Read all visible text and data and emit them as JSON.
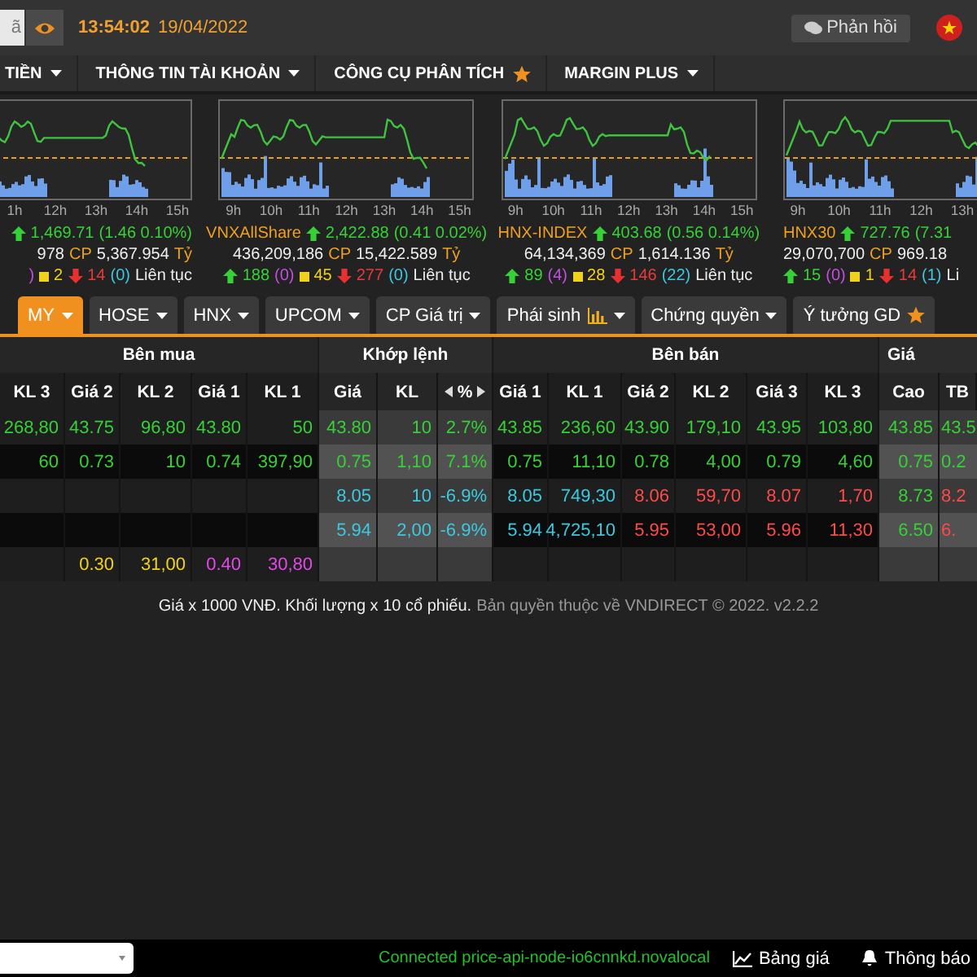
{
  "topbar": {
    "search": {
      "placeholder": "ã"
    },
    "time": "13:54:02",
    "date": "19/04/2022",
    "feedback": "Phản hồi"
  },
  "menu": [
    {
      "label": "TIỀN",
      "kind": "dropdown"
    },
    {
      "label": "THÔNG TIN TÀI KHOẢN",
      "kind": "dropdown"
    },
    {
      "label": "CÔNG CỤ PHÂN TÍCH",
      "kind": "favorite"
    },
    {
      "label": "MARGIN PLUS",
      "kind": "dropdown"
    }
  ],
  "indices": [
    {
      "value": "1,469.71",
      "change": "(1.46 0.10%)",
      "volume": "978",
      "volume_label": "CP",
      "value_traded": "5,367.954",
      "value_unit": "Tỷ",
      "ceilings": ")",
      "unchanged": "2",
      "declines": "14",
      "floors": "(0)",
      "session": "Liên tục",
      "time_labels": [
        "1h",
        "12h",
        "13h",
        "14h",
        "15h"
      ]
    },
    {
      "name": "VNXAllShare",
      "value": "2,422.88",
      "change": "(0.41 0.02%)",
      "volume": "436,209,186",
      "volume_label": "CP",
      "value_traded": "15,422.589",
      "value_unit": "Tỷ",
      "advances": "188",
      "ceilings": "(0)",
      "unchanged": "45",
      "declines": "277",
      "floors": "(0)",
      "session": "Liên tục",
      "time_labels": [
        "9h",
        "10h",
        "11h",
        "12h",
        "13h",
        "14h",
        "15h"
      ]
    },
    {
      "name": "HNX-INDEX",
      "value": "403.68",
      "change": "(0.56 0.14%)",
      "volume": "64,134,369",
      "volume_label": "CP",
      "value_traded": "1,614.136",
      "value_unit": "Tỷ",
      "advances": "89",
      "ceilings": "(4)",
      "unchanged": "28",
      "declines": "146",
      "floors": "(22)",
      "session": "Liên tục",
      "time_labels": [
        "9h",
        "10h",
        "11h",
        "12h",
        "13h",
        "14h",
        "15h"
      ]
    },
    {
      "name": "HNX30",
      "value": "727.76",
      "change": "(7.31",
      "volume": "29,070,700",
      "volume_label": "CP",
      "value_traded": "969.18",
      "advances": "15",
      "ceilings": "(0)",
      "unchanged": "1",
      "declines": "14",
      "floors": "(1)",
      "session": "Li",
      "time_labels": [
        "9h",
        "10h",
        "11h",
        "12h",
        "13h"
      ]
    }
  ],
  "tabs": [
    {
      "label": "MY",
      "kind": "dropdown",
      "selected": true
    },
    {
      "label": "HOSE",
      "kind": "dropdown",
      "selected": false
    },
    {
      "label": "HNX",
      "kind": "dropdown",
      "selected": false
    },
    {
      "label": "UPCOM",
      "kind": "dropdown",
      "selected": false
    },
    {
      "label": "CP Giá trị",
      "kind": "dropdown",
      "selected": false
    },
    {
      "label": "Phái sinh",
      "kind": "chart-dropdown",
      "selected": false
    },
    {
      "label": "Chứng quyền",
      "kind": "dropdown",
      "selected": false
    },
    {
      "label": "Ý tưởng GD",
      "kind": "favorite",
      "selected": false
    }
  ],
  "table": {
    "groups": [
      {
        "label": "Bên mua",
        "kind": "plain",
        "columns": [
          {
            "label": "KL 3"
          },
          {
            "label": "Giá 2"
          },
          {
            "label": "KL 2"
          },
          {
            "label": "Giá 1"
          },
          {
            "label": "KL 1"
          }
        ]
      },
      {
        "label": "Khớp lệnh",
        "kind": "shaded",
        "columns": [
          {
            "label": "Giá"
          },
          {
            "label": "KL"
          },
          {
            "label": "%",
            "kind": "toggle"
          }
        ]
      },
      {
        "label": "Bên bán",
        "kind": "plain",
        "columns": [
          {
            "label": "Giá 1"
          },
          {
            "label": "KL 1"
          },
          {
            "label": "Giá 2"
          },
          {
            "label": "KL 2"
          },
          {
            "label": "Giá 3"
          },
          {
            "label": "KL 3"
          }
        ]
      },
      {
        "label": "Giá",
        "kind": "shaded",
        "columns": [
          {
            "label": "Cao"
          },
          {
            "label": "TB"
          }
        ]
      }
    ],
    "rows": [
      {
        "cells": [
          {
            "text": "268,80",
            "color": "#36d136"
          },
          {
            "text": "43.75",
            "color": "#36d136"
          },
          {
            "text": "96,80",
            "color": "#36d136"
          },
          {
            "text": "43.80",
            "color": "#36d136"
          },
          {
            "text": "50",
            "color": "#36d136"
          },
          {
            "text": "43.80",
            "color": "#36d136"
          },
          {
            "text": "10",
            "color": "#36d136"
          },
          {
            "text": "2.7%",
            "color": "#36d136"
          },
          {
            "text": "43.85",
            "color": "#36d136"
          },
          {
            "text": "236,60",
            "color": "#36d136"
          },
          {
            "text": "43.90",
            "color": "#36d136"
          },
          {
            "text": "179,10",
            "color": "#36d136"
          },
          {
            "text": "43.95",
            "color": "#36d136"
          },
          {
            "text": "103,80",
            "color": "#36d136"
          },
          {
            "text": "43.85",
            "color": "#36d136"
          },
          {
            "text": "43.5",
            "color": "#36d136"
          }
        ]
      },
      {
        "cells": [
          {
            "text": "60",
            "color": "#36d136"
          },
          {
            "text": "0.73",
            "color": "#36d136"
          },
          {
            "text": "10",
            "color": "#36d136"
          },
          {
            "text": "0.74",
            "color": "#36d136"
          },
          {
            "text": "397,90",
            "color": "#36d136"
          },
          {
            "text": "0.75",
            "color": "#36d136"
          },
          {
            "text": "1,10",
            "color": "#36d136"
          },
          {
            "text": "7.1%",
            "color": "#36d136"
          },
          {
            "text": "0.75",
            "color": "#36d136"
          },
          {
            "text": "11,10",
            "color": "#36d136"
          },
          {
            "text": "0.78",
            "color": "#36d136"
          },
          {
            "text": "4,00",
            "color": "#36d136"
          },
          {
            "text": "0.79",
            "color": "#36d136"
          },
          {
            "text": "4,60",
            "color": "#36d136"
          },
          {
            "text": "0.75",
            "color": "#36d136"
          },
          {
            "text": "0.2",
            "color": "#36d136"
          }
        ]
      },
      {
        "cells": [
          null,
          null,
          null,
          null,
          null,
          {
            "text": "8.05",
            "color": "#3cc9e0"
          },
          {
            "text": "10",
            "color": "#3cc9e0"
          },
          {
            "text": "-6.9%",
            "color": "#3cc9e0"
          },
          {
            "text": "8.05",
            "color": "#3cc9e0"
          },
          {
            "text": "749,30",
            "color": "#3cc9e0"
          },
          {
            "text": "8.06",
            "color": "#ff4a4a"
          },
          {
            "text": "59,70",
            "color": "#ff4a4a"
          },
          {
            "text": "8.07",
            "color": "#ff4a4a"
          },
          {
            "text": "1,70",
            "color": "#ff4a4a"
          },
          {
            "text": "8.73",
            "color": "#36d136"
          },
          {
            "text": "8.2",
            "color": "#ff4a4a"
          }
        ]
      },
      {
        "cells": [
          null,
          null,
          null,
          null,
          null,
          {
            "text": "5.94",
            "color": "#3cc9e0"
          },
          {
            "text": "2,00",
            "color": "#3cc9e0"
          },
          {
            "text": "-6.9%",
            "color": "#3cc9e0"
          },
          {
            "text": "5.94",
            "color": "#3cc9e0"
          },
          {
            "text": "4,725,10",
            "color": "#3cc9e0"
          },
          {
            "text": "5.95",
            "color": "#ff4a4a"
          },
          {
            "text": "53,00",
            "color": "#ff4a4a"
          },
          {
            "text": "5.96",
            "color": "#ff4a4a"
          },
          {
            "text": "11,30",
            "color": "#ff4a4a"
          },
          {
            "text": "6.50",
            "color": "#36d136"
          },
          {
            "text": "6.",
            "color": "#ff4a4a"
          }
        ]
      },
      {
        "cells": [
          null,
          {
            "text": "0.30",
            "color": "#f0d21e"
          },
          {
            "text": "31,00",
            "color": "#f0d21e"
          },
          {
            "text": "0.40",
            "color": "#e348e8"
          },
          {
            "text": "30,80",
            "color": "#e348e8"
          },
          null,
          null,
          null,
          null,
          null,
          null,
          null,
          null,
          null,
          null,
          null
        ]
      }
    ]
  },
  "footer": {
    "note": "Giá x 1000 VNĐ. Khối lượng x 10 cổ phiếu.",
    "copyright": "Bản quyền thuộc về VNDIRECT © 2022. v2.2.2"
  },
  "status_bar": {
    "connection": "Connected price-api-node-io6cnnkd.novalocal",
    "links": [
      {
        "label": "Bảng giá",
        "kind": "board"
      },
      {
        "label": "Thông báo",
        "kind": "notifications"
      }
    ]
  }
}
